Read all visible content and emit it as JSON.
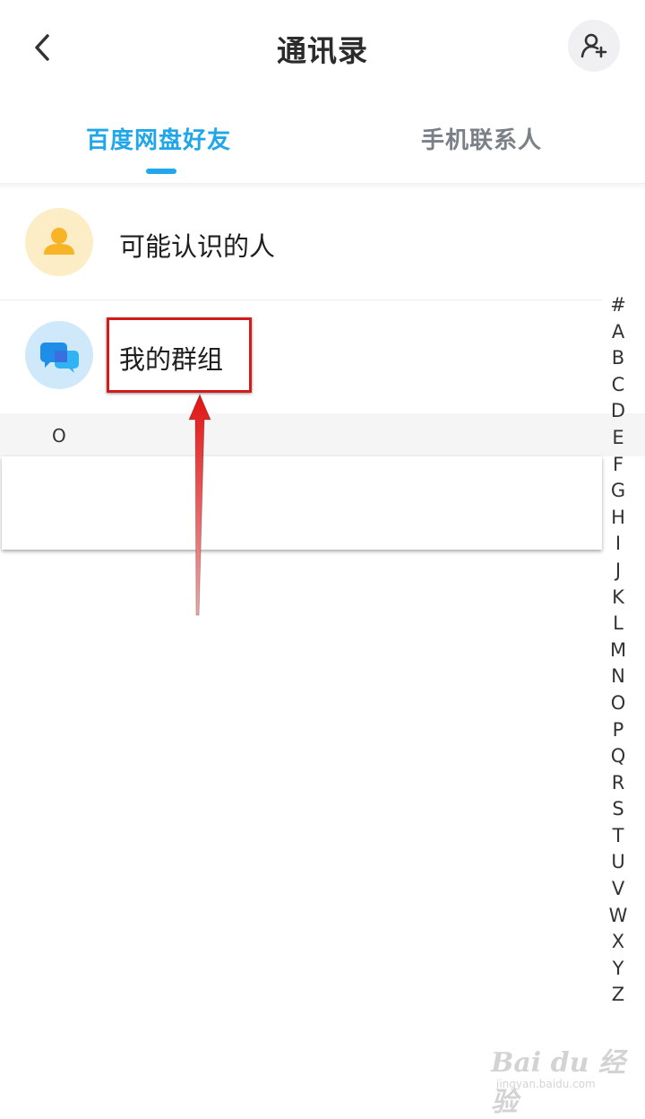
{
  "header": {
    "title": "通讯录"
  },
  "tabs": [
    {
      "label": "百度网盘好友",
      "active": true
    },
    {
      "label": "手机联系人",
      "active": false
    }
  ],
  "rows": [
    {
      "label": "可能认识的人",
      "icon": "person-icon"
    },
    {
      "label": "我的群组",
      "icon": "chat-bubbles-icon"
    }
  ],
  "section": {
    "letter": "O"
  },
  "index_letters": [
    "#",
    "A",
    "B",
    "C",
    "D",
    "E",
    "F",
    "G",
    "H",
    "I",
    "J",
    "K",
    "L",
    "M",
    "N",
    "O",
    "P",
    "Q",
    "R",
    "S",
    "T",
    "U",
    "V",
    "W",
    "X",
    "Y",
    "Z"
  ],
  "watermark": {
    "brand": "Bai du 经验",
    "sub": "jingyan.baidu.com"
  },
  "colors": {
    "accent": "#20a6ea",
    "annotation": "#d41a1a"
  }
}
